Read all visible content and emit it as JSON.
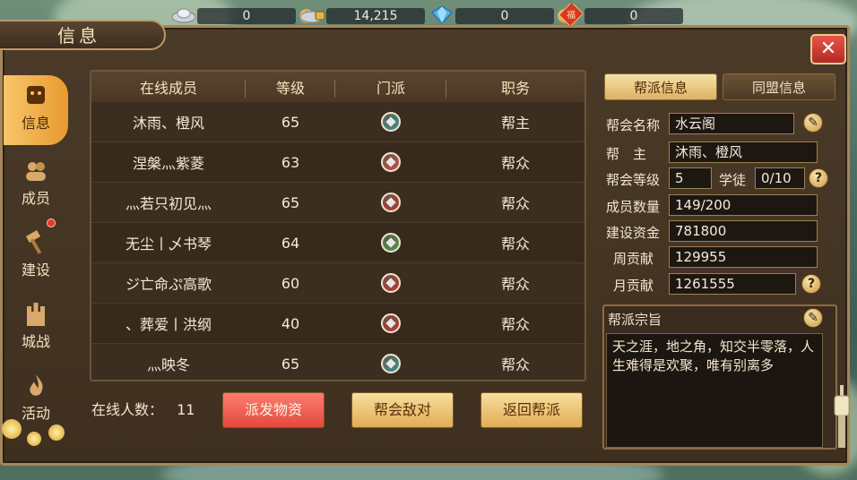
{
  "resources": [
    {
      "icon": "silver-ingot-icon",
      "value": "0",
      "plus": true
    },
    {
      "icon": "locked-silver-icon",
      "value": "14,215",
      "plus": false
    },
    {
      "icon": "diamond-icon",
      "value": "0",
      "plus": true
    },
    {
      "icon": "fortune-coin-icon",
      "value": "0",
      "plus": false
    }
  ],
  "plus_label": "+",
  "fortune_char": "福",
  "window": {
    "title": "信息",
    "close_label": "✕"
  },
  "nav": [
    {
      "label": "信息",
      "icon": "info-icon",
      "active": true
    },
    {
      "label": "成员",
      "icon": "members-icon",
      "active": false
    },
    {
      "label": "建设",
      "icon": "hammer-icon",
      "active": false
    },
    {
      "label": "城战",
      "icon": "castle-icon",
      "active": false
    },
    {
      "label": "活动",
      "icon": "flame-icon",
      "active": false
    }
  ],
  "table": {
    "headers": [
      "在线成员",
      "等级",
      "门派",
      "职务"
    ],
    "rows": [
      {
        "name": "沐雨、橙风",
        "level": "65",
        "sect_color": "#3a9b9a",
        "role": "帮主"
      },
      {
        "name": "涅槃灬紫菱",
        "level": "63",
        "sect_color": "#d8504a",
        "role": "帮众"
      },
      {
        "name": "灬若只初见灬",
        "level": "65",
        "sect_color": "#c9332d",
        "role": "帮众"
      },
      {
        "name": "无尘丨乄书琴",
        "level": "64",
        "sect_color": "#4ea34a",
        "role": "帮众"
      },
      {
        "name": "ジ亡命ぷ高歌",
        "level": "60",
        "sect_color": "#c9332d",
        "role": "帮众"
      },
      {
        "name": "、葬爱丨洪纲",
        "level": "40",
        "sect_color": "#c9332d",
        "role": "帮众"
      },
      {
        "name": "灬映冬",
        "level": "65",
        "sect_color": "#3a9b9a",
        "role": "帮众"
      }
    ]
  },
  "online": {
    "label": "在线人数：",
    "count": "11"
  },
  "buttons": {
    "distribute": "派发物资",
    "enemy": "帮会敌对",
    "return": "返回帮派"
  },
  "right_tabs": {
    "guild_info": "帮派信息",
    "alliance_info": "同盟信息"
  },
  "guild": {
    "name_label": "帮会名称",
    "name": "水云阁",
    "leader_label": "帮　主",
    "leader": "沐雨、橙风",
    "level_label": "帮会等级",
    "level": "5",
    "apprentice_label": "学徒",
    "apprentice": "0/10",
    "members_label": "成员数量",
    "members": "149/200",
    "funds_label": "建设资金",
    "funds": "781800",
    "weekly_label": "周贡献",
    "weekly": "129955",
    "monthly_label": "月贡献",
    "monthly": "1261555",
    "purpose_label": "帮派宗旨",
    "purpose": "天之涯，地之角，知交半零落，人生难得是欢聚，唯有别离多"
  },
  "help_label": "?",
  "colors": {
    "active_nav": "#f0b04a",
    "red_button": "#e85a4e",
    "gold_button": "#e8bd6a"
  }
}
